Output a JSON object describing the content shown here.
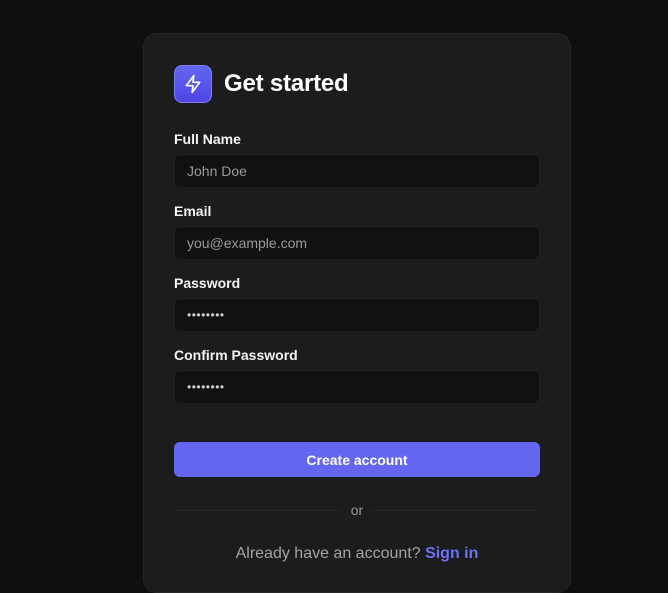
{
  "title": "Get started",
  "logo_icon": "lightning-bolt-icon",
  "accent_color": "#6366f1",
  "fields": [
    {
      "label": "Full Name",
      "placeholder": "John Doe",
      "value": ""
    },
    {
      "label": "Email",
      "placeholder": "you@example.com",
      "value": ""
    },
    {
      "label": "Password",
      "placeholder": "",
      "value": "••••••••"
    },
    {
      "label": "Confirm Password",
      "placeholder": "",
      "value": "••••••••"
    }
  ],
  "submit_label": "Create account",
  "divider_text": "or",
  "footer": {
    "prompt": "Already have an account?",
    "link": "Sign in"
  }
}
